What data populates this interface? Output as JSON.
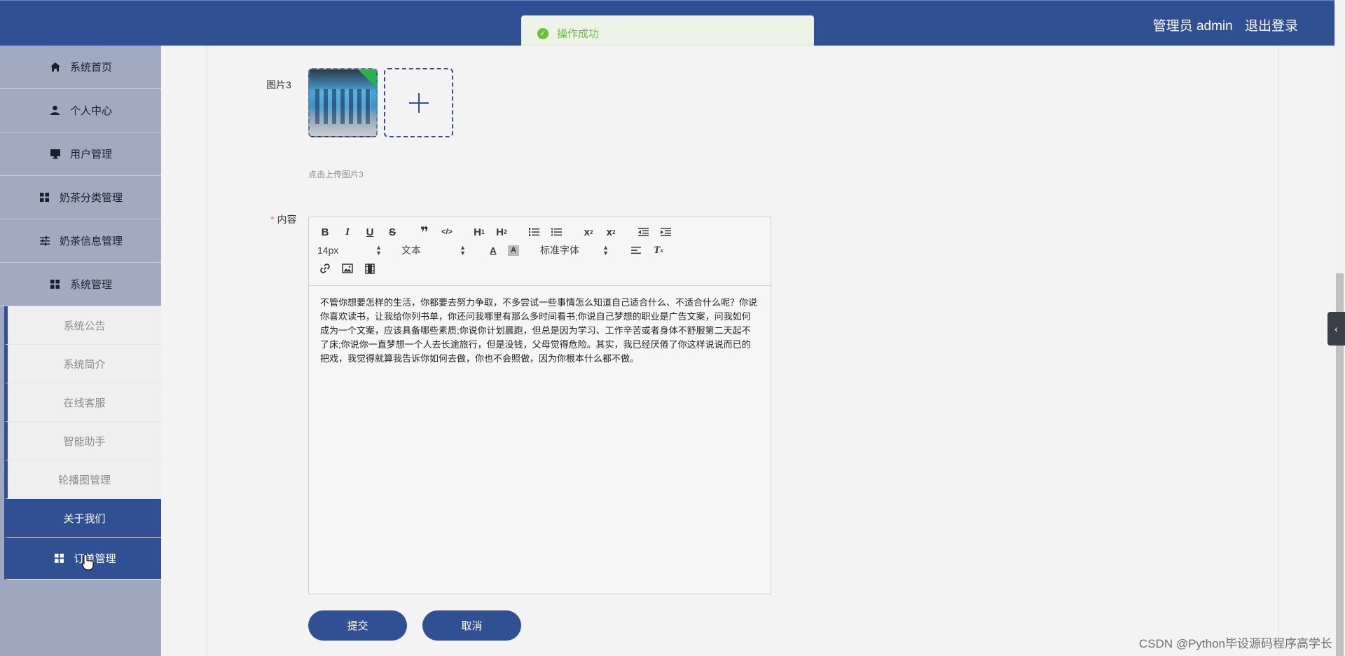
{
  "header": {
    "user_label": "管理员 admin",
    "logout_label": "退出登录",
    "bg_color": "#314f93"
  },
  "toast": {
    "message": "操作成功",
    "icon": "check-circle-icon",
    "color": "#67c23a"
  },
  "sidebar": {
    "items": [
      {
        "label": "系统首页",
        "icon": "home-icon"
      },
      {
        "label": "个人中心",
        "icon": "person-icon"
      },
      {
        "label": "用户管理",
        "icon": "monitor-icon"
      },
      {
        "label": "奶茶分类管理",
        "icon": "grid-icon"
      },
      {
        "label": "奶茶信息管理",
        "icon": "sliders-icon"
      },
      {
        "label": "系统管理",
        "icon": "grid-icon"
      }
    ],
    "sub_items": [
      {
        "label": "系统公告"
      },
      {
        "label": "系统简介"
      },
      {
        "label": "在线客服"
      },
      {
        "label": "智能助手"
      },
      {
        "label": "轮播图管理"
      },
      {
        "label": "关于我们",
        "active": true
      }
    ],
    "order_item": {
      "label": "订单管理",
      "icon": "grid-icon"
    }
  },
  "form": {
    "image3_label": "图片3",
    "image3_hint": "点击上传图片3",
    "content_label": "内容",
    "required_mark": "*",
    "editor": {
      "font_size": "14px",
      "text_type": "文本",
      "font_family": "标准字体",
      "toolbar_buttons": [
        "bold-icon",
        "italic-icon",
        "underline-icon",
        "strikethrough-icon",
        "quote-icon",
        "code-icon",
        "h1-icon",
        "h2-icon",
        "ordered-list-icon",
        "bullet-list-icon",
        "subscript-icon",
        "superscript-icon",
        "outdent-icon",
        "indent-icon",
        "font-color-icon",
        "background-color-icon",
        "align-icon",
        "clear-format-icon",
        "link-icon",
        "image-icon",
        "video-icon"
      ],
      "text": "不管你想要怎样的生活，你都要去努力争取，不多尝试一些事情怎么知道自己适合什么、不适合什么呢？你说你喜欢读书，让我给你列书单，你还问我哪里有那么多时间看书;你说自己梦想的职业是广告文案，问我如何成为一个文案，应该具备哪些素质;你说你计划晨跑，但总是因为学习、工作辛苦或者身体不舒服第二天起不了床;你说你一直梦想一个人去长途旅行，但是没钱，父母觉得危险。其实，我已经厌倦了你这样说说而已的把戏，我觉得就算我告诉你如何去做，你也不会照做，因为你根本什么都不做。"
    },
    "submit_label": "提交",
    "cancel_label": "取消"
  },
  "watermark": "CSDN @Python毕设源码程序高学长"
}
